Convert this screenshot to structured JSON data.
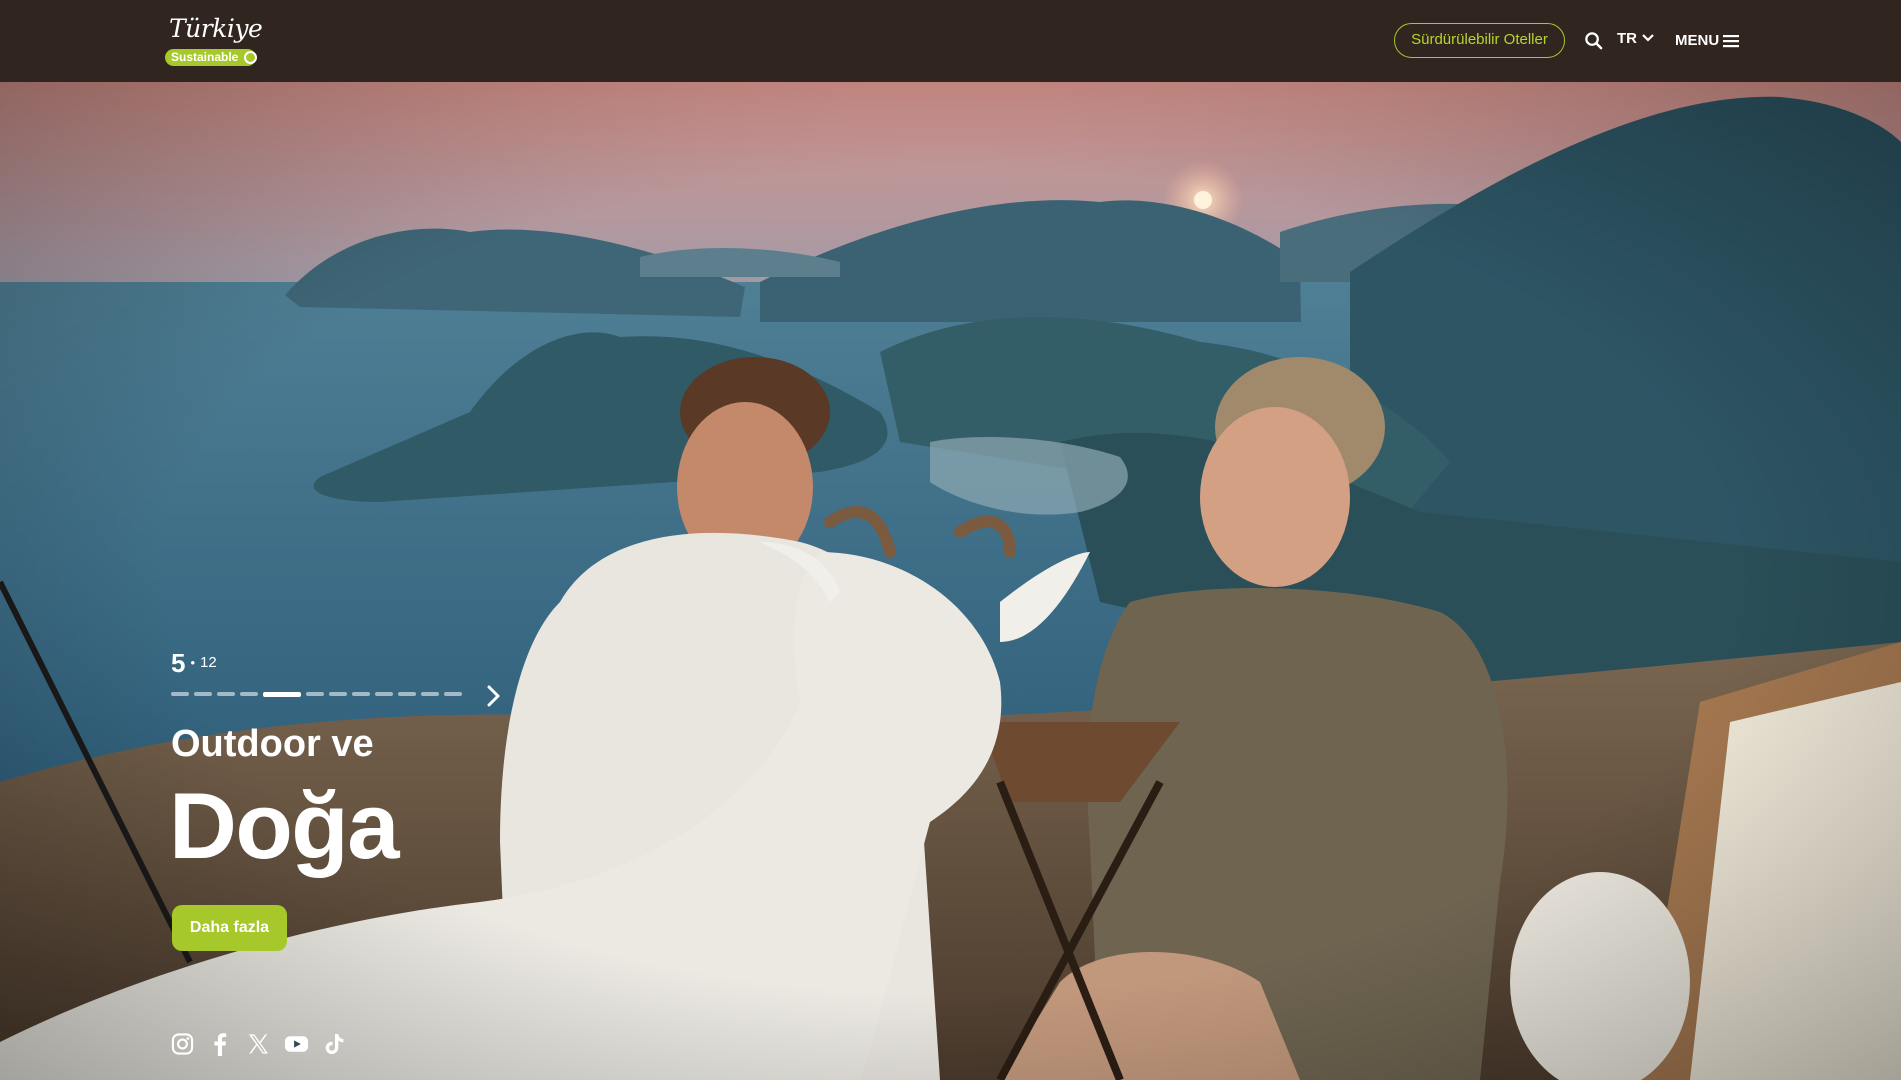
{
  "header": {
    "logo_text": "Türkiye",
    "logo_badge": "Sustainable",
    "hotels_button": "Sürdürülebilir Oteller",
    "language": "TR",
    "menu_label": "MENU",
    "icons": [
      "search-icon",
      "chevron-down-icon",
      "hamburger-icon"
    ]
  },
  "hero": {
    "slide_current": "5",
    "slide_separator": "•",
    "slide_total": "12",
    "active_slide_index": 5,
    "title_line1": "Outdoor ve",
    "title_line2": "Doğa",
    "cta_label": "Daha fazla"
  },
  "social": {
    "icons": [
      "instagram-icon",
      "facebook-icon",
      "x-icon",
      "youtube-icon",
      "tiktok-icon"
    ]
  },
  "colors": {
    "header_bg": "#30251f",
    "accent": "#a6c82a",
    "accent_text": "#b7d431"
  }
}
